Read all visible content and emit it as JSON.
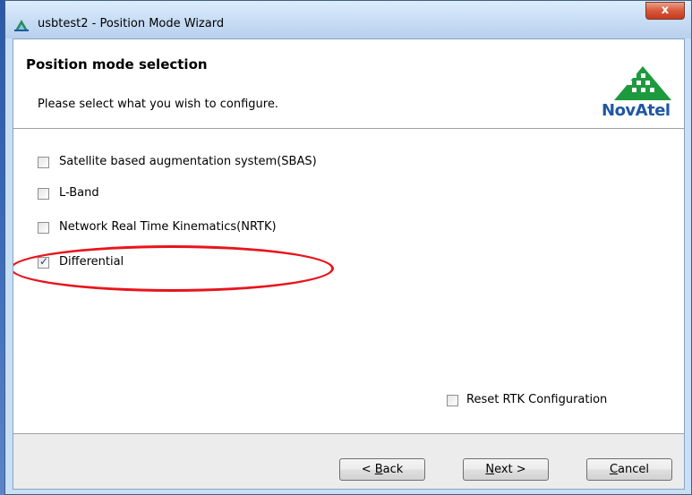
{
  "window": {
    "title": "usbtest2 - Position Mode Wizard",
    "close_glyph": "x"
  },
  "header": {
    "title": "Position mode selection",
    "subtitle": "Please select what you wish to configure.",
    "logo_text": "NovAtel"
  },
  "options": [
    {
      "label": "Satellite based augmentation system(SBAS)",
      "checked": false
    },
    {
      "label": "L-Band",
      "checked": false
    },
    {
      "label": "Network Real Time Kinematics(NRTK)",
      "checked": false
    },
    {
      "label": "Differential",
      "checked": true
    }
  ],
  "reset": {
    "label": "Reset RTK Configuration",
    "checked": false
  },
  "buttons": {
    "back": {
      "prefix": "< ",
      "mnemonic": "B",
      "rest": "ack"
    },
    "next": {
      "mnemonic": "N",
      "rest": "ext >"
    },
    "cancel": {
      "mnemonic": "C",
      "rest": "ancel"
    }
  },
  "icons": {
    "app": "satellite-dish-icon",
    "check": "✓"
  },
  "colors": {
    "annotation": "#e8141c",
    "brand": "#1f57a3",
    "logo_green": "#1e9a3e"
  }
}
